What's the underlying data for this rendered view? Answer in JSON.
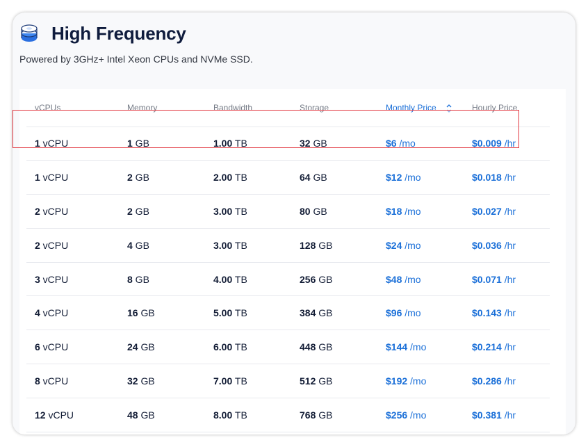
{
  "header": {
    "title": "High Frequency",
    "subtitle": "Powered by 3GHz+ Intel Xeon CPUs and NVMe SSD."
  },
  "colors": {
    "title": "#0f1c3d",
    "accent": "#1a6fd8",
    "highlight": "#e2353e"
  },
  "table": {
    "columns": [
      "vCPUs",
      "Memory",
      "Bandwidth",
      "Storage",
      "Monthly Price",
      "Hourly Price"
    ],
    "sorted_column": "Monthly Price",
    "rows": [
      {
        "vcpu_num": "1",
        "vcpu_unit": " vCPU",
        "mem_num": "1",
        "mem_unit": " GB",
        "bw_num": "1.00",
        "bw_unit": " TB",
        "sto_num": "32",
        "sto_unit": " GB",
        "mo_num": "$6",
        "mo_unit": " /mo",
        "hr_num": "$0.009",
        "hr_unit": " /hr"
      },
      {
        "vcpu_num": "1",
        "vcpu_unit": " vCPU",
        "mem_num": "2",
        "mem_unit": " GB",
        "bw_num": "2.00",
        "bw_unit": " TB",
        "sto_num": "64",
        "sto_unit": " GB",
        "mo_num": "$12",
        "mo_unit": " /mo",
        "hr_num": "$0.018",
        "hr_unit": " /hr"
      },
      {
        "vcpu_num": "2",
        "vcpu_unit": " vCPU",
        "mem_num": "2",
        "mem_unit": " GB",
        "bw_num": "3.00",
        "bw_unit": " TB",
        "sto_num": "80",
        "sto_unit": " GB",
        "mo_num": "$18",
        "mo_unit": " /mo",
        "hr_num": "$0.027",
        "hr_unit": " /hr"
      },
      {
        "vcpu_num": "2",
        "vcpu_unit": " vCPU",
        "mem_num": "4",
        "mem_unit": " GB",
        "bw_num": "3.00",
        "bw_unit": " TB",
        "sto_num": "128",
        "sto_unit": " GB",
        "mo_num": "$24",
        "mo_unit": " /mo",
        "hr_num": "$0.036",
        "hr_unit": " /hr"
      },
      {
        "vcpu_num": "3",
        "vcpu_unit": " vCPU",
        "mem_num": "8",
        "mem_unit": " GB",
        "bw_num": "4.00",
        "bw_unit": " TB",
        "sto_num": "256",
        "sto_unit": " GB",
        "mo_num": "$48",
        "mo_unit": " /mo",
        "hr_num": "$0.071",
        "hr_unit": " /hr"
      },
      {
        "vcpu_num": "4",
        "vcpu_unit": " vCPU",
        "mem_num": "16",
        "mem_unit": " GB",
        "bw_num": "5.00",
        "bw_unit": " TB",
        "sto_num": "384",
        "sto_unit": " GB",
        "mo_num": "$96",
        "mo_unit": " /mo",
        "hr_num": "$0.143",
        "hr_unit": " /hr"
      },
      {
        "vcpu_num": "6",
        "vcpu_unit": " vCPU",
        "mem_num": "24",
        "mem_unit": " GB",
        "bw_num": "6.00",
        "bw_unit": " TB",
        "sto_num": "448",
        "sto_unit": " GB",
        "mo_num": "$144",
        "mo_unit": " /mo",
        "hr_num": "$0.214",
        "hr_unit": " /hr"
      },
      {
        "vcpu_num": "8",
        "vcpu_unit": " vCPU",
        "mem_num": "32",
        "mem_unit": " GB",
        "bw_num": "7.00",
        "bw_unit": " TB",
        "sto_num": "512",
        "sto_unit": " GB",
        "mo_num": "$192",
        "mo_unit": " /mo",
        "hr_num": "$0.286",
        "hr_unit": " /hr"
      },
      {
        "vcpu_num": "12",
        "vcpu_unit": " vCPU",
        "mem_num": "48",
        "mem_unit": " GB",
        "bw_num": "8.00",
        "bw_unit": " TB",
        "sto_num": "768",
        "sto_unit": " GB",
        "mo_num": "$256",
        "mo_unit": " /mo",
        "hr_num": "$0.381",
        "hr_unit": " /hr"
      }
    ],
    "selected_row_index": 0
  }
}
